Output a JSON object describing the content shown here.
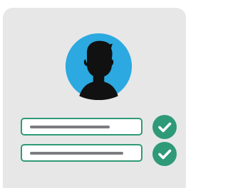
{
  "colors": {
    "card_background": "#e7e7e8",
    "avatar_circle": "#2ba9e0",
    "silhouette": "#111111",
    "field_border": "#2f9a77",
    "field_value_line": "#7d7d80",
    "check_circle": "#2f9a77",
    "check_mark": "#ffffff"
  },
  "avatar": {
    "icon": "user-silhouette-icon"
  },
  "fields": [
    {
      "name": "username-field",
      "value": "",
      "valid": true
    },
    {
      "name": "password-field",
      "value": "",
      "valid": true
    }
  ],
  "status_icons": [
    "check-circle-icon",
    "check-circle-icon"
  ]
}
